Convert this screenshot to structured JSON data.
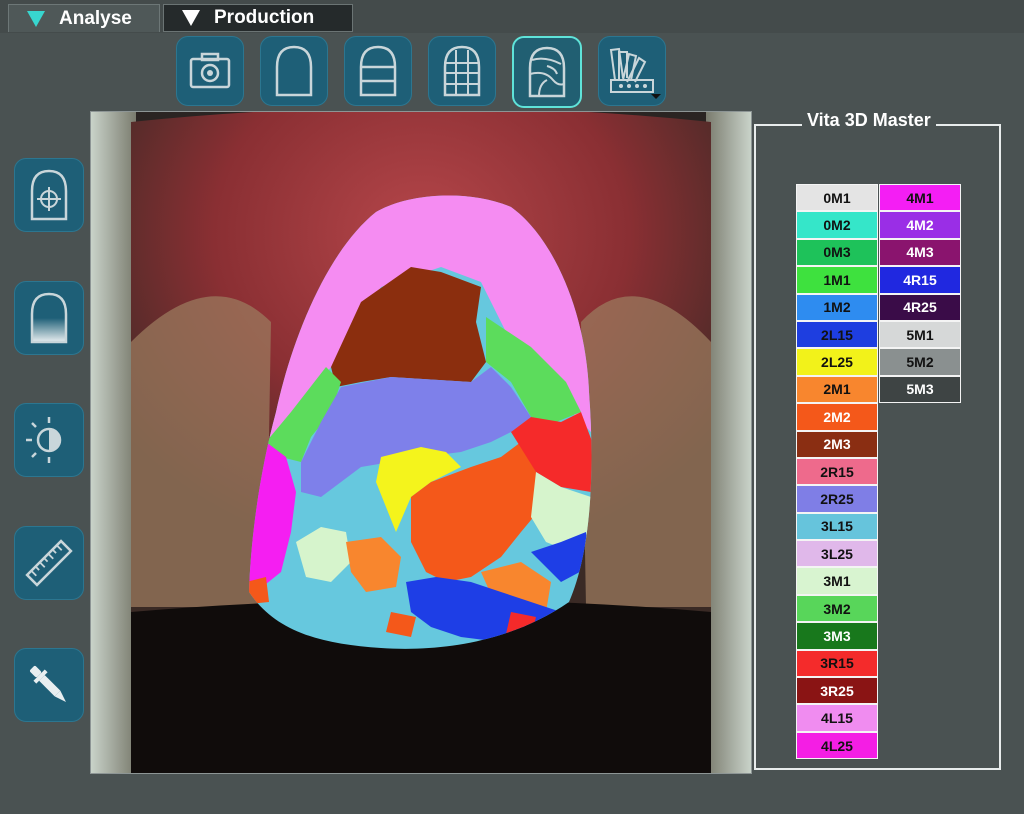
{
  "tabs": [
    {
      "label": "Analyse",
      "active": true
    },
    {
      "label": "Production",
      "active": false
    }
  ],
  "toolbar": {
    "top_icons": [
      "camera-icon",
      "tooth-outline-icon",
      "tooth-thirds-icon",
      "tooth-grid-icon",
      "tooth-map-icon",
      "shade-guide-icon"
    ],
    "selected": "tooth-map-icon",
    "left_icons": [
      "tooth-target-icon",
      "tooth-gradient-icon",
      "brightness-icon",
      "ruler-icon",
      "eyedropper-icon"
    ]
  },
  "panel": {
    "title": "Vita 3D Master",
    "column1": [
      {
        "label": "0M1",
        "color": "#e4e4e4",
        "text": "#111111"
      },
      {
        "label": "0M2",
        "color": "#35e6c9",
        "text": "#111111"
      },
      {
        "label": "0M3",
        "color": "#1ec25a",
        "text": "#111111"
      },
      {
        "label": "1M1",
        "color": "#3ee13e",
        "text": "#111111"
      },
      {
        "label": "1M2",
        "color": "#2e8cf0",
        "text": "#111111"
      },
      {
        "label": "2L15",
        "color": "#1e3ee0",
        "text": "#111111"
      },
      {
        "label": "2L25",
        "color": "#f2f21a",
        "text": "#111111"
      },
      {
        "label": "2M1",
        "color": "#f8862e",
        "text": "#111111"
      },
      {
        "label": "2M2",
        "color": "#f4581a",
        "text": "#ffffff"
      },
      {
        "label": "2M3",
        "color": "#8a2e12",
        "text": "#ffffff"
      },
      {
        "label": "2R15",
        "color": "#ee6a8c",
        "text": "#111111"
      },
      {
        "label": "2R25",
        "color": "#7f7ee6",
        "text": "#111111"
      },
      {
        "label": "3L15",
        "color": "#66c4dc",
        "text": "#111111"
      },
      {
        "label": "3L25",
        "color": "#e0b8ea",
        "text": "#111111"
      },
      {
        "label": "3M1",
        "color": "#d8f4d0",
        "text": "#111111"
      },
      {
        "label": "3M2",
        "color": "#58d65a",
        "text": "#111111"
      },
      {
        "label": "3M3",
        "color": "#18781c",
        "text": "#ffffff"
      },
      {
        "label": "3R15",
        "color": "#f42b2b",
        "text": "#111111"
      },
      {
        "label": "3R25",
        "color": "#8a1414",
        "text": "#ffffff"
      },
      {
        "label": "4L15",
        "color": "#f08cf0",
        "text": "#111111"
      },
      {
        "label": "4L25",
        "color": "#f41ee4",
        "text": "#111111"
      }
    ],
    "column2": [
      {
        "label": "4M1",
        "color": "#f41ef4",
        "text": "#111111"
      },
      {
        "label": "4M2",
        "color": "#9a2ee6",
        "text": "#ffffff"
      },
      {
        "label": "4M3",
        "color": "#8a146e",
        "text": "#ffffff"
      },
      {
        "label": "4R15",
        "color": "#2028e0",
        "text": "#ffffff"
      },
      {
        "label": "4R25",
        "color": "#3a0c48",
        "text": "#ffffff"
      },
      {
        "label": "5M1",
        "color": "#d6d8d8",
        "text": "#111111"
      },
      {
        "label": "5M2",
        "color": "#8a9090",
        "text": "#111111"
      },
      {
        "label": "5M3",
        "color": "#3e4444",
        "text": "#ffffff"
      }
    ]
  },
  "image_region_colors": {
    "pink_incisal": "#f58cf2",
    "brown": "#8b2e0e",
    "green": "#5cdc5c",
    "lavender": "#7e80ea",
    "magenta": "#f51ef2",
    "light_blue": "#66c8de",
    "yellow": "#f4f41c",
    "orange": "#f4581a",
    "red": "#f52a2a",
    "pale_green": "#d6f4cc",
    "blue": "#1e3ee6",
    "light_orange": "#f8862e"
  }
}
